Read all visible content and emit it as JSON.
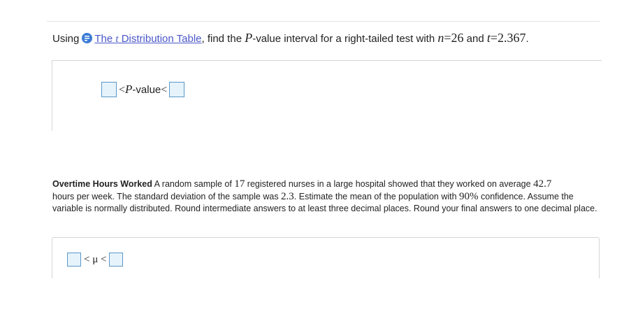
{
  "question1": {
    "prefix": "Using",
    "link_italic": "t",
    "link_pre": "The ",
    "link_post": " Distribution Table",
    "text_before_n": ", find the ",
    "p_var": "P",
    "text_mid": "-value interval for a right-tailed test with ",
    "n_var": "n",
    "n_eq": "=26",
    "and": " and ",
    "t_var": "t",
    "t_eq": "=2.367",
    "period": ".",
    "answer": {
      "lt1": "<",
      "p": "P",
      "value_label": "-value",
      "lt2": "<",
      "lower_value": "",
      "upper_value": ""
    }
  },
  "question2": {
    "title": "Overtime Hours Worked",
    "t1": " A random sample of ",
    "n": "17",
    "t2": " registered nurses in a large hospital showed that they worked on average ",
    "mean": "42.7",
    "t3": "hours per week. The standard deviation of the sample was ",
    "sd": "2.3",
    "t4": ". Estimate the mean of the population with ",
    "conf": "90%",
    "t5": " confidence. Assume the variable is normally distributed. Round intermediate answers to at least three decimal places. Round your final answers to one decimal place.",
    "answer": {
      "lt1": "<",
      "mu": "μ",
      "lt2": "<",
      "lower_value": "",
      "upper_value": ""
    }
  },
  "colors": {
    "link": "#4a57c9",
    "icon": "#3a7bd5",
    "box_border": "#5a97c8",
    "box_fill": "#e6f3fb"
  },
  "icons": {
    "info": "info-icon"
  }
}
